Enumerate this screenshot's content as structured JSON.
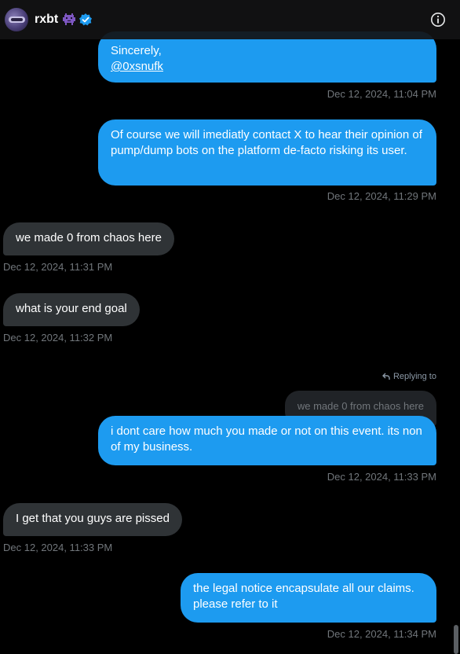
{
  "header": {
    "handle": "rxbt",
    "icons": [
      "avatar",
      "alien-emoji-icon",
      "verified-badge-icon",
      "info-icon"
    ]
  },
  "messages": [
    {
      "side": "out",
      "lines": [
        "Sincerely,"
      ],
      "link": "@0xsnufk",
      "time": "Dec 12, 2024, 11:04 PM"
    },
    {
      "side": "out",
      "text": "Of course we will imediatly contact X to hear their opinion of pump/dump bots on the platform de-facto risking its user.",
      "time": "Dec 12, 2024, 11:29 PM"
    },
    {
      "side": "in",
      "text": "we made 0 from chaos here",
      "time": "Dec 12, 2024, 11:31 PM"
    },
    {
      "side": "in",
      "text": "what is your end goal",
      "time": "Dec 12, 2024, 11:32 PM"
    },
    {
      "side": "out",
      "reply_label": "Replying to",
      "quoted": "we made 0 from chaos here",
      "text": "i dont care how much you made or not on this event. its non of my business.",
      "time": "Dec 12, 2024, 11:33 PM"
    },
    {
      "side": "in",
      "text": "I get that you guys are pissed",
      "time": "Dec 12, 2024, 11:33 PM"
    },
    {
      "side": "out",
      "text": "the legal notice encapsulate all our claims. please refer to it",
      "time": "Dec 12, 2024, 11:34 PM"
    }
  ],
  "colors": {
    "outgoing_bubble": "#1d9bf0",
    "incoming_bubble": "#2f3336",
    "background": "#000000",
    "timestamp": "#71767b"
  }
}
